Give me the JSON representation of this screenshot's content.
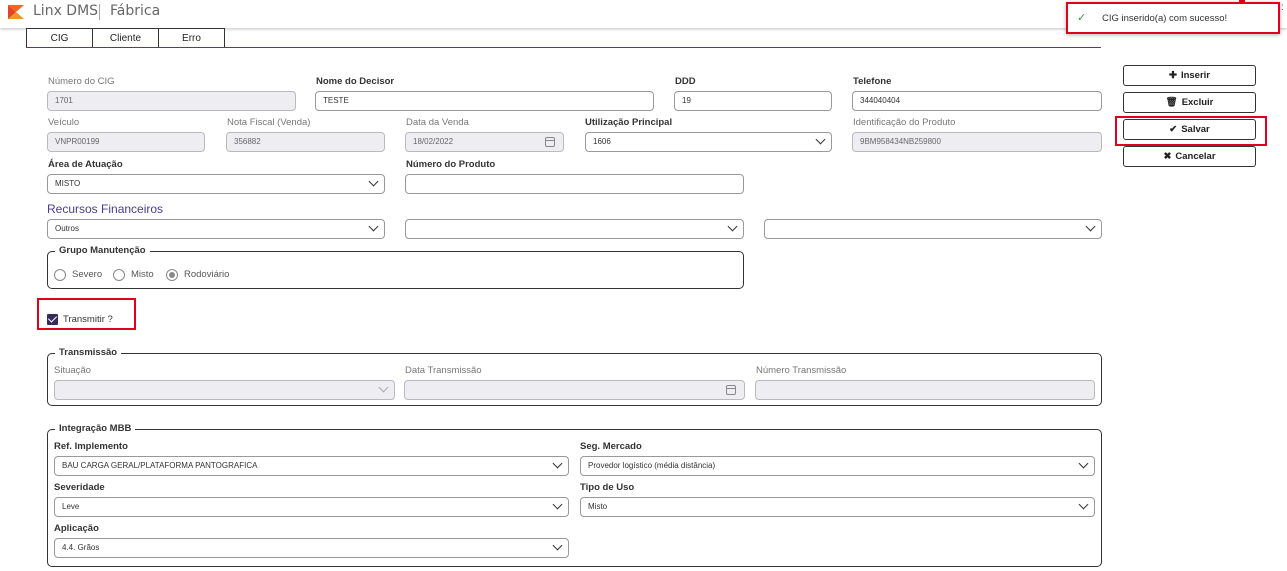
{
  "header": {
    "app_name": "Linx DMS",
    "module": "Fábrica"
  },
  "toast": {
    "message": "CIG inserido(a) com sucesso!",
    "icon": "check-icon",
    "close": ":"
  },
  "tabs": [
    {
      "label": "CIG"
    },
    {
      "label": "Cliente"
    },
    {
      "label": "Erro"
    }
  ],
  "form": {
    "numero_cig": {
      "label": "Número do CIG",
      "value": "1701"
    },
    "nome_decisor": {
      "label": "Nome do Decisor",
      "value": "TESTE"
    },
    "ddd": {
      "label": "DDD",
      "value": "19"
    },
    "telefone": {
      "label": "Telefone",
      "value": "344040404"
    },
    "veiculo": {
      "label": "Veículo",
      "value": "VNPR00199"
    },
    "nota_fiscal": {
      "label": "Nota Fiscal (Venda)",
      "value": "356882"
    },
    "data_venda": {
      "label": "Data da Venda",
      "value": "18/02/2022"
    },
    "utilizacao": {
      "label": "Utilização Principal",
      "value": "1606"
    },
    "identificacao": {
      "label": "Identificação do Produto",
      "value": "9BM958434NB259800"
    },
    "area_atuacao": {
      "label": "Área de Atuação",
      "value": "MISTO"
    },
    "numero_produto": {
      "label": "Número do Produto",
      "value": ""
    },
    "recursos_title": "Recursos Financeiros",
    "recursos": [
      "Outros",
      "",
      ""
    ],
    "grupo_manutencao": {
      "legend": "Grupo Manutenção",
      "options": [
        "Severo",
        "Misto",
        "Rodoviário"
      ],
      "selected": "Rodoviário"
    },
    "transmitir": {
      "label": "Transmitir ?",
      "checked": true
    },
    "transmissao": {
      "legend": "Transmissão",
      "situacao": {
        "label": "Situação",
        "value": ""
      },
      "data": {
        "label": "Data Transmissão",
        "value": ""
      },
      "numero": {
        "label": "Número Transmissão",
        "value": ""
      }
    },
    "mbb": {
      "legend": "Integração MBB",
      "ref_implemento": {
        "label": "Ref. Implemento",
        "value": "BAU CARGA GERAL/PLATAFORMA PANTOGRAFICA"
      },
      "seg_mercado": {
        "label": "Seg. Mercado",
        "value": "Provedor logístico (média distância)"
      },
      "severidade": {
        "label": "Severidade",
        "value": "Leve"
      },
      "tipo_uso": {
        "label": "Tipo de Uso",
        "value": "Misto"
      },
      "aplicacao": {
        "label": "Aplicação",
        "value": "4.4. Grãos"
      }
    }
  },
  "actions": {
    "inserir": {
      "label": "Inserir",
      "icon": "plus-icon"
    },
    "excluir": {
      "label": "Excluir",
      "icon": "trash-icon"
    },
    "salvar": {
      "label": "Salvar",
      "icon": "check-icon"
    },
    "cancelar": {
      "label": "Cancelar",
      "icon": "x-icon"
    }
  },
  "colors": {
    "accent": "#4b3b8c",
    "highlight": "#e0001b",
    "logo": "#f26522"
  }
}
